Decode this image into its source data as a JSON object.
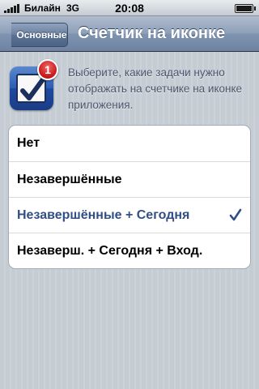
{
  "status_bar": {
    "carrier": "Билайн",
    "network": "3G",
    "time": "20:08"
  },
  "nav_bar": {
    "back_label": "Основные",
    "title": "Счетчик на иконке"
  },
  "header": {
    "icon": "checkbox-app-icon",
    "badge": "1",
    "description": "Выберите, какие задачи нужно отображать на счетчике на иконке приложения."
  },
  "options": [
    {
      "label": "Нет",
      "selected": false
    },
    {
      "label": "Незавершённые",
      "selected": false
    },
    {
      "label": "Незавершённые + Сегодня",
      "selected": true
    },
    {
      "label": "Незаверш. + Сегодня + Вход.",
      "selected": false
    }
  ],
  "colors": {
    "nav_accent": "#6d83a1",
    "selected_text": "#324f85",
    "badge": "#c51414"
  }
}
